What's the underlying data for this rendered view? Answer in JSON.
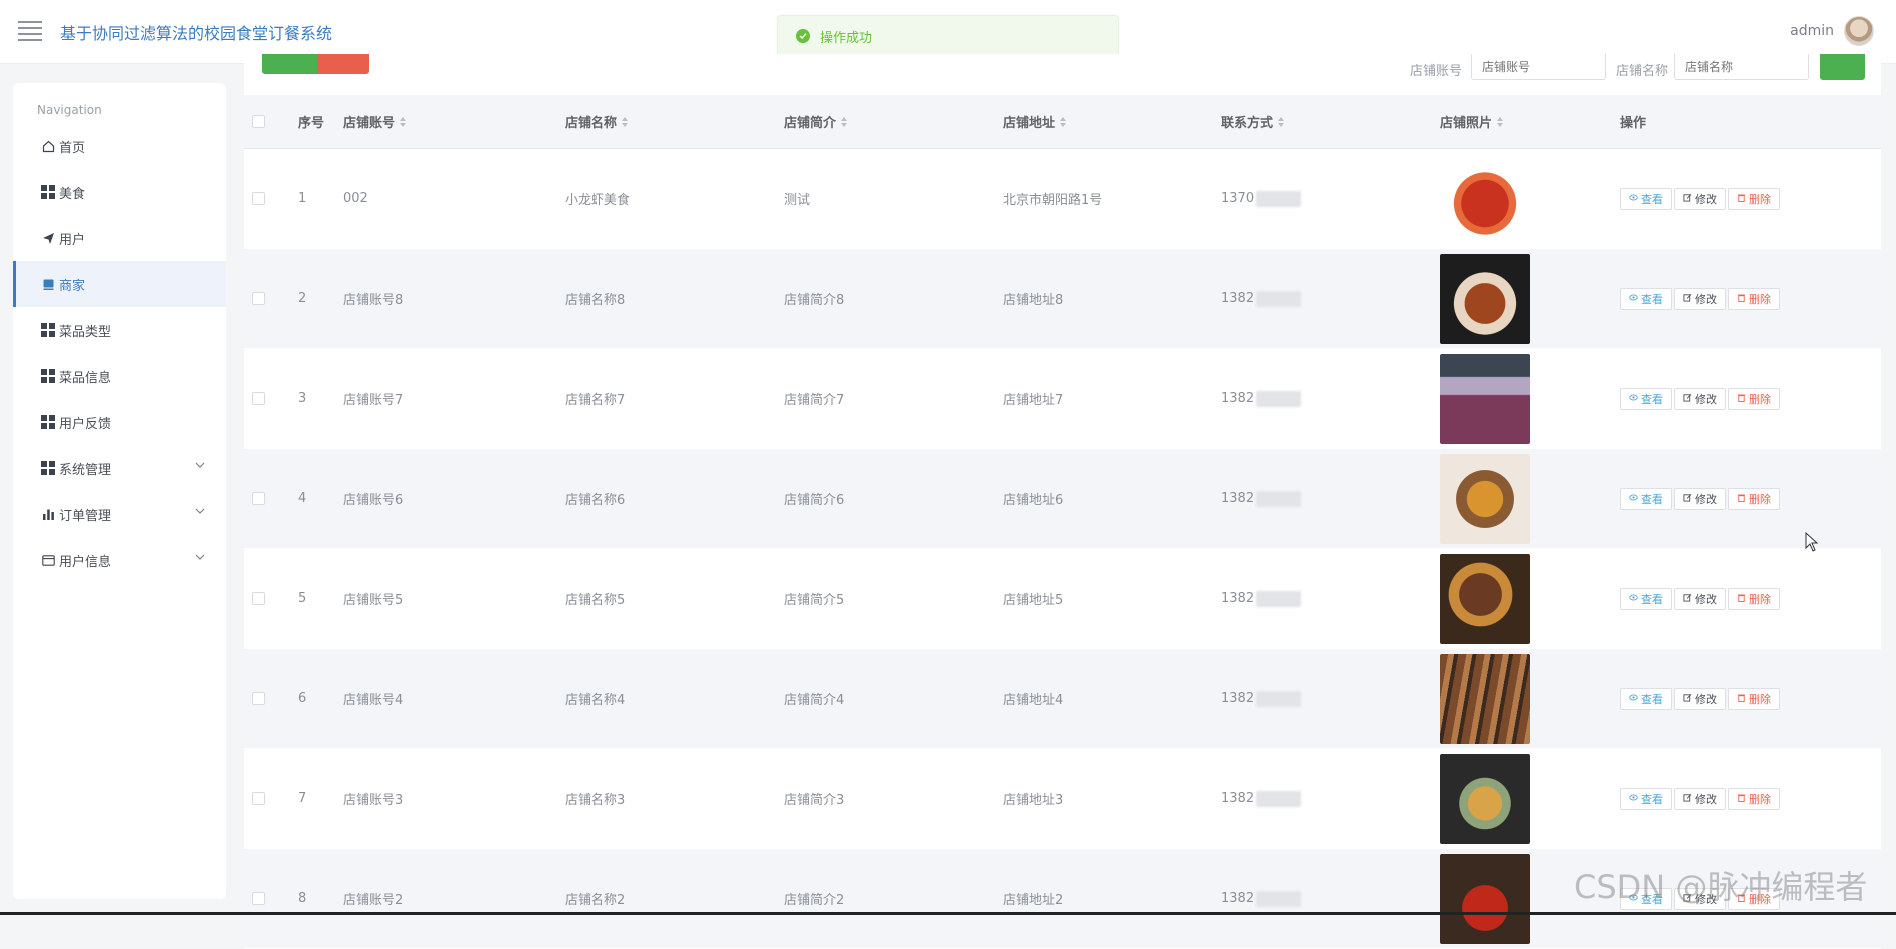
{
  "header": {
    "app_title": "基于协同过滤算法的校园食堂订餐系统",
    "user_name": "admin"
  },
  "toast": {
    "message": "操作成功"
  },
  "sidebar": {
    "caption": "Navigation",
    "items": [
      {
        "label": "首页",
        "icon": "home-icon",
        "has_chevron": false,
        "active": false
      },
      {
        "label": "美食",
        "icon": "grid-icon",
        "has_chevron": false,
        "active": false
      },
      {
        "label": "用户",
        "icon": "send-icon",
        "has_chevron": false,
        "active": false
      },
      {
        "label": "商家",
        "icon": "store-icon",
        "has_chevron": false,
        "active": true
      },
      {
        "label": "菜品类型",
        "icon": "grid-icon",
        "has_chevron": false,
        "active": false
      },
      {
        "label": "菜品信息",
        "icon": "grid-icon",
        "has_chevron": false,
        "active": false
      },
      {
        "label": "用户反馈",
        "icon": "grid-icon",
        "has_chevron": false,
        "active": false
      },
      {
        "label": "系统管理",
        "icon": "grid-icon",
        "has_chevron": true,
        "active": false
      },
      {
        "label": "订单管理",
        "icon": "bar-chart-icon",
        "has_chevron": true,
        "active": false
      },
      {
        "label": "用户信息",
        "icon": "card-icon",
        "has_chevron": true,
        "active": false
      }
    ]
  },
  "search": {
    "account_label": "店铺账号",
    "account_placeholder": "店铺账号",
    "name_label": "店铺名称",
    "name_placeholder": "店铺名称"
  },
  "table": {
    "columns": [
      "序号",
      "店铺账号",
      "店铺名称",
      "店铺简介",
      "店铺地址",
      "联系方式",
      "店铺照片",
      "操作"
    ],
    "rows": [
      {
        "index": "1",
        "account": "002",
        "name": "小龙虾美食",
        "intro": "测试",
        "address": "北京市朝阳路1号",
        "phone": "1370",
        "photo": "crayfish"
      },
      {
        "index": "2",
        "account": "店铺账号8",
        "name": "店铺名称8",
        "intro": "店铺简介8",
        "address": "店铺地址8",
        "phone": "1382",
        "photo": "stir-fry"
      },
      {
        "index": "3",
        "account": "店铺账号7",
        "name": "店铺名称7",
        "intro": "店铺简介7",
        "address": "店铺地址7",
        "phone": "1382",
        "photo": "smoothie"
      },
      {
        "index": "4",
        "account": "店铺账号6",
        "name": "店铺名称6",
        "intro": "店铺简介6",
        "address": "店铺地址6",
        "phone": "1382",
        "photo": "clay-pot"
      },
      {
        "index": "5",
        "account": "店铺账号5",
        "name": "店铺名称5",
        "intro": "店铺简介5",
        "address": "店铺地址5",
        "phone": "1382",
        "photo": "grill"
      },
      {
        "index": "6",
        "account": "店铺账号4",
        "name": "店铺名称4",
        "intro": "店铺简介4",
        "address": "店铺地址4",
        "phone": "1382",
        "photo": "skewers"
      },
      {
        "index": "7",
        "account": "店铺账号3",
        "name": "店铺名称3",
        "intro": "店铺简介3",
        "address": "店铺地址3",
        "phone": "1382",
        "photo": "fine-dining"
      },
      {
        "index": "8",
        "account": "店铺账号2",
        "name": "店铺名称2",
        "intro": "店铺简介2",
        "address": "店铺地址2",
        "phone": "1382",
        "photo": "spicy-dish"
      }
    ],
    "actions": {
      "view": "查看",
      "edit": "修改",
      "delete": "删除"
    }
  },
  "watermark": "CSDN @脉冲编程者",
  "colors": {
    "primary": "#3a7cc0",
    "success": "#67c23a",
    "danger": "#e8604c",
    "add_button": "#4caf50"
  }
}
